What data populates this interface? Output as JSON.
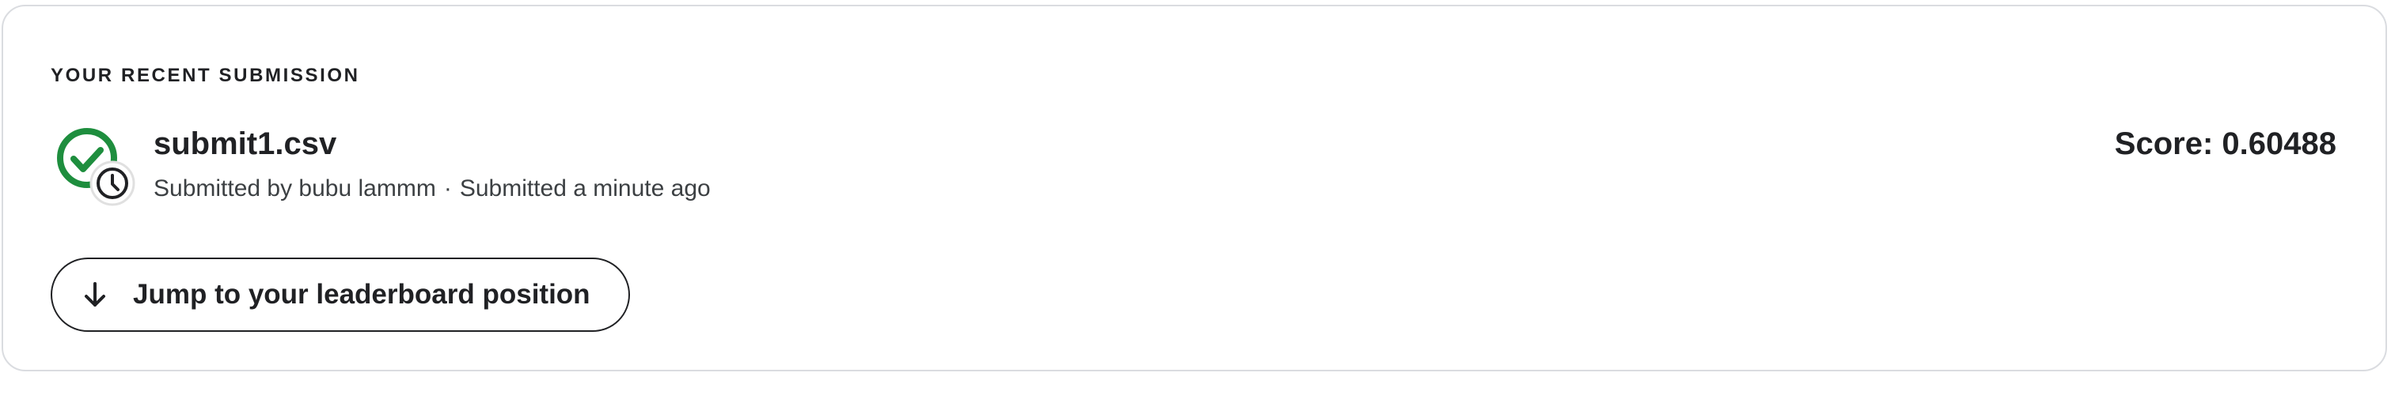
{
  "section": {
    "title": "YOUR RECENT SUBMISSION"
  },
  "submission": {
    "status_icon": "check-circle-with-clock-icon",
    "status_color": "#1e8e3e",
    "file_name": "submit1.csv",
    "submitted_by": "Submitted by bubu lammm",
    "separator": "·",
    "submitted_time": "Submitted a minute ago",
    "score": "Score: 0.60488"
  },
  "actions": {
    "jump_icon": "arrow-down-icon",
    "jump_label": "Jump to your leaderboard position"
  }
}
